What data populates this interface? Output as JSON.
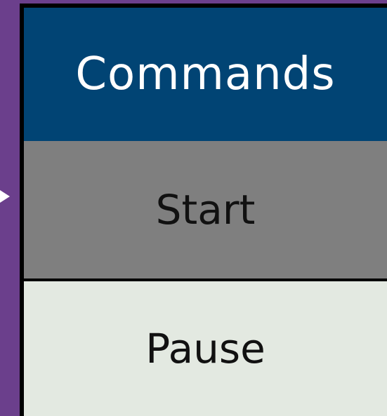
{
  "commands_table": {
    "header_label": "Commands",
    "items": [
      {
        "label": "Start",
        "state": "selected"
      },
      {
        "label": "Pause",
        "state": "normal"
      }
    ]
  },
  "colors": {
    "background": "#6b3f8c",
    "header": "#014474",
    "selected_item": "#7f7f7f",
    "normal_item": "#e3e9e1",
    "pointer": "#ffffff"
  },
  "icons": {
    "selection_pointer": "triangle-right-icon"
  }
}
